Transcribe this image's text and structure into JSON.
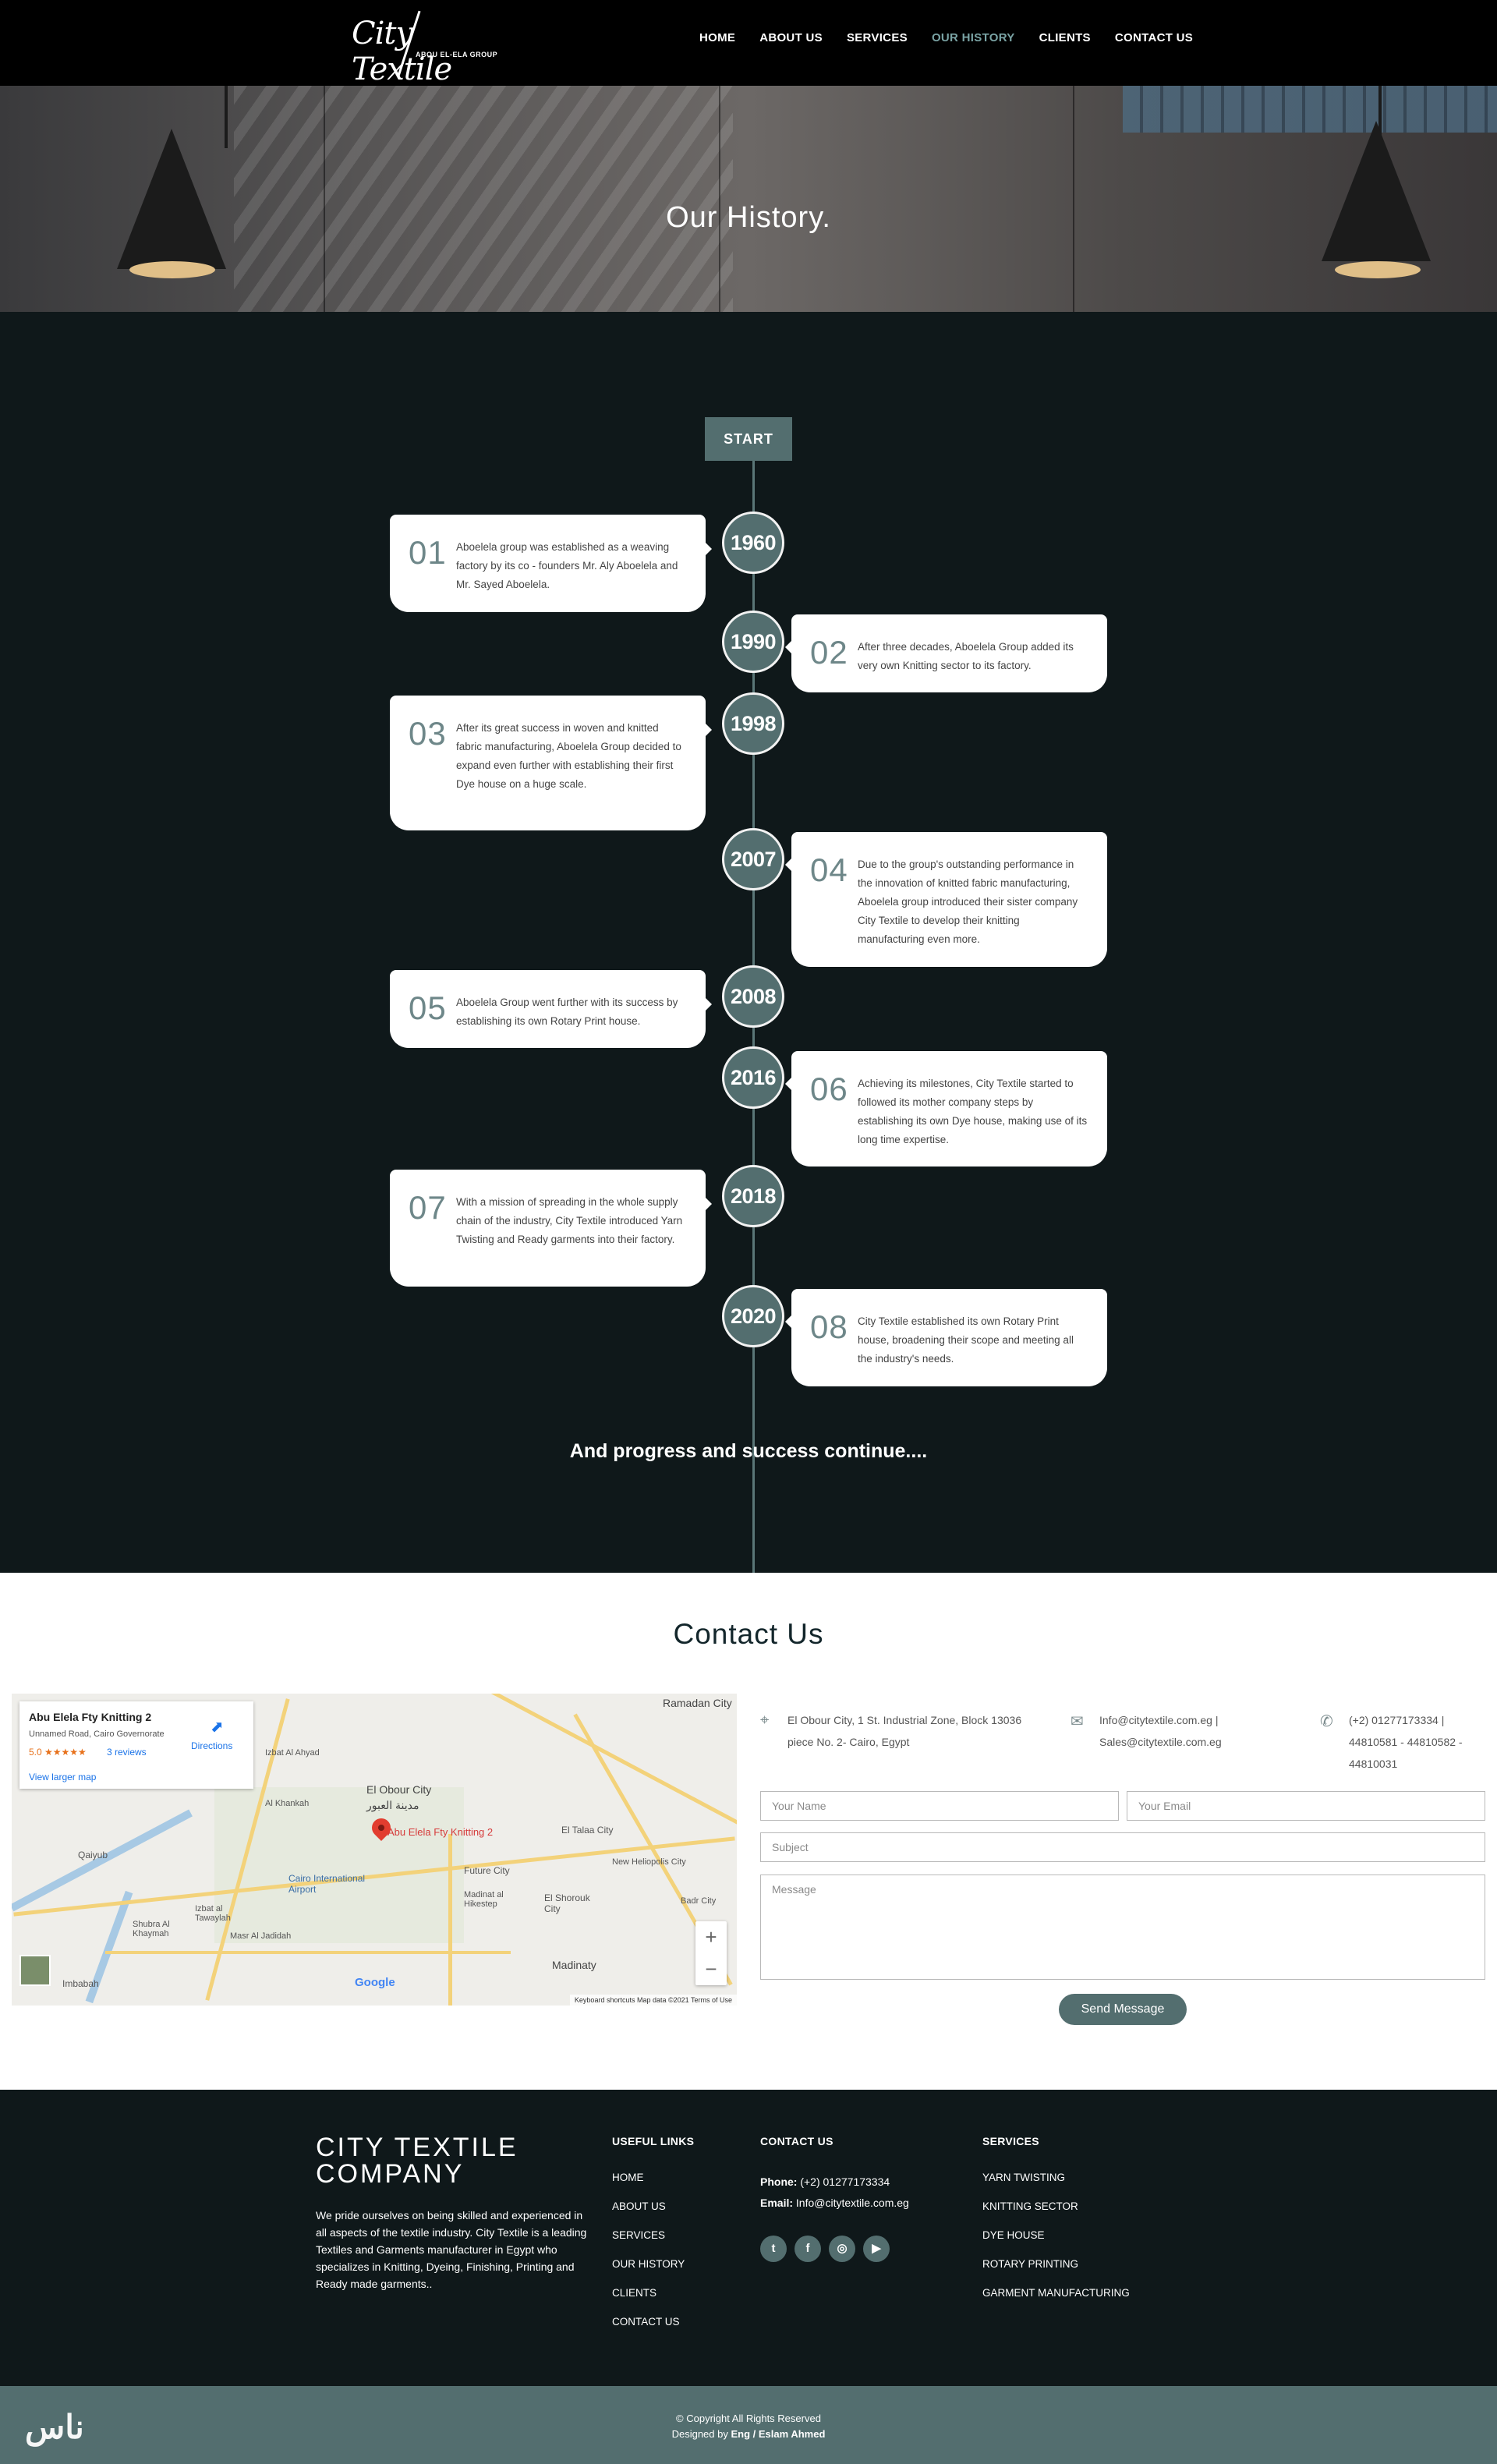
{
  "nav": {
    "logo_text": "City Textile",
    "logo_sub": "ABOU EL-ELA GROUP",
    "items": [
      "HOME",
      "ABOUT US",
      "SERVICES",
      "OUR HISTORY",
      "CLIENTS",
      "CONTACT US"
    ],
    "active_item": "OUR HISTORY"
  },
  "hero": {
    "title": "Our History."
  },
  "timeline": {
    "start_label": "START",
    "events": [
      {
        "year": "1960",
        "num": "01",
        "text": "Aboelela group was established as a weaving factory by its co - founders Mr. Aly Aboelela and Mr. Sayed Aboelela."
      },
      {
        "year": "1990",
        "num": "02",
        "text": "After three decades, Aboelela Group added its very own Knitting sector to its factory."
      },
      {
        "year": "1998",
        "num": "03",
        "text": "After its great success in woven and knitted fabric manufacturing, Aboelela Group decided to expand even further with establishing their first Dye house on a huge scale."
      },
      {
        "year": "2007",
        "num": "04",
        "text": "Due to the group's outstanding performance in the innovation of knitted fabric manufacturing, Aboelela group introduced their sister company City Textile to develop their knitting manufacturing even more."
      },
      {
        "year": "2008",
        "num": "05",
        "text": "Aboelela Group went further with its success by establishing its own Rotary Print house."
      },
      {
        "year": "2016",
        "num": "06",
        "text": "Achieving its milestones, City Textile started to followed its mother company steps by establishing its own Dye house, making use of its long time expertise."
      },
      {
        "year": "2018",
        "num": "07",
        "text": "With a mission of spreading in the whole supply chain of the industry, City Textile introduced Yarn Twisting and Ready garments into their factory."
      },
      {
        "year": "2020",
        "num": "08",
        "text": "City Textile established its own Rotary Print house, broadening their scope and meeting all the industry's needs."
      }
    ],
    "closing": "And progress and success continue...."
  },
  "contact": {
    "title": "Contact Us",
    "address": "El Obour City, 1 St. Industrial Zone, Block 13036 piece No. 2- Cairo, Egypt",
    "emails": "Info@citytextile.com.eg | Sales@citytextile.com.eg",
    "phones": "(+2) 01277173334 | 44810581 - 44810582 - 44810031",
    "name_placeholder": "Your Name",
    "email_placeholder": "Your Email",
    "subject_placeholder": "Subject",
    "message_placeholder": "Message",
    "send_label": "Send Message",
    "map": {
      "place_name": "Abu Elela Fty Knitting 2",
      "place_address": "Unnamed Road, Cairo Governorate",
      "rating": "5.0 ★★★★★",
      "reviews": "3 reviews",
      "directions": "Directions",
      "view_larger": "View larger map",
      "labels": [
        "Ramadan City",
        "El Obour City",
        "مدينة العبور",
        "Abu Elela Fty Knitting 2",
        "El Talaa City",
        "Cairo International Airport",
        "Future City",
        "Madinat al Hikestep",
        "El Shorouk City",
        "New Heliopolis City",
        "Madinaty",
        "Badr City",
        "Qaiyub",
        "Izbat al Tawaylah",
        "Masr Al Jadidah",
        "Shubra Al Khaymah",
        "Imbabah",
        "Al Khankah",
        "Izbat Al Ahyad"
      ],
      "zoom_in": "+",
      "zoom_out": "−",
      "attribution": "Keyboard shortcuts   Map data ©2021   Terms of Use",
      "google": "Google"
    }
  },
  "footer": {
    "brand": "CITY TEXTILE COMPANY",
    "description": "We pride ourselves on being skilled and experienced in all aspects of the textile industry. City Textile is a leading Textiles and Garments manufacturer in Egypt who specializes in Knitting, Dyeing, Finishing, Printing and Ready made garments..",
    "useful_links_title": "USEFUL LINKS",
    "useful_links": [
      "HOME",
      "ABOUT US",
      "SERVICES",
      "OUR HISTORY",
      "CLIENTS",
      "CONTACT US"
    ],
    "contact_title": "CONTACT US",
    "phone_label": "Phone:",
    "phone": "(+2) 01277173334",
    "email_label": "Email:",
    "email": "Info@citytextile.com.eg",
    "social_icons": [
      "twitter-icon",
      "facebook-icon",
      "instagram-icon",
      "youtube-icon"
    ],
    "services_title": "SERVICES",
    "services": [
      "YARN TWISTING",
      "KNITTING SECTOR",
      "DYE HOUSE",
      "ROTARY PRINTING",
      "GARMENT MANUFACTURING"
    ],
    "copyright": "© Copyright All Rights Reserved",
    "designed_by_label": "Designed by",
    "designer": "Eng / Eslam Ahmed",
    "corner_mark": "ناس"
  },
  "colors": {
    "accent": "#536e6f",
    "dark_bg": "#0f181a",
    "active_nav": "#7aa3a4"
  }
}
